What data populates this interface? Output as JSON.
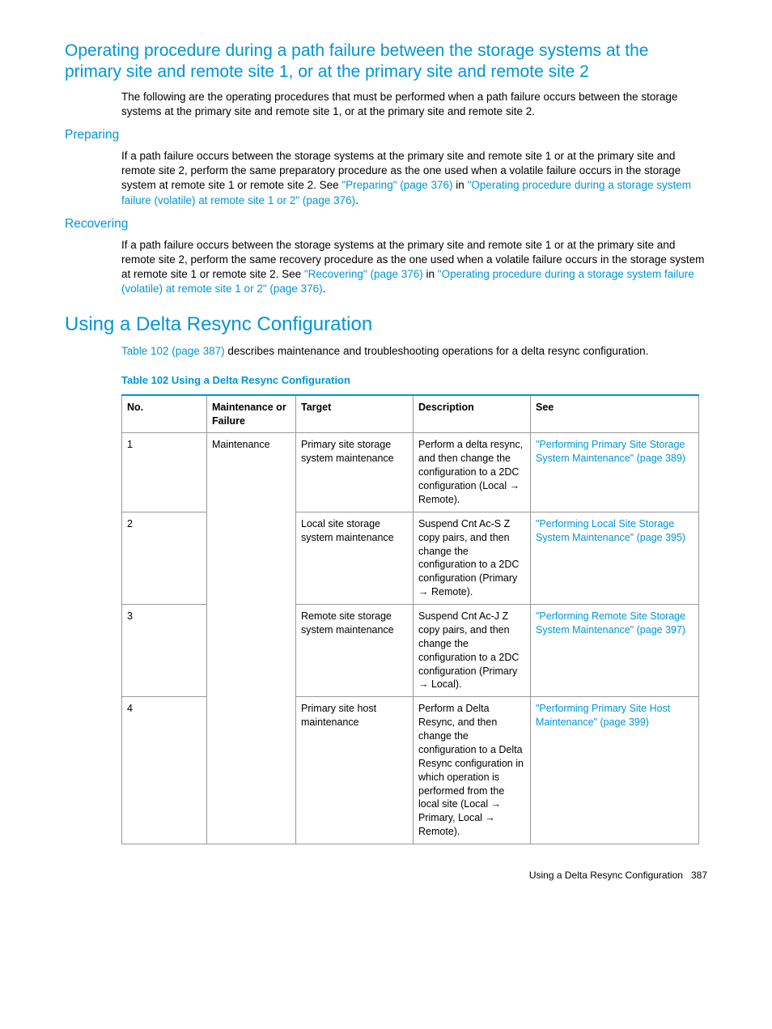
{
  "heading1": "Operating procedure during a path failure between the storage systems at the primary site and remote site 1, or at the primary site and remote site 2",
  "para1": "The following are the operating procedures that must be performed when a path failure occurs between the storage systems at the primary site and remote site 1, or at the primary site and remote site 2.",
  "preparing": {
    "title": "Preparing",
    "text_before": "If a path failure occurs between the storage systems at the primary site and remote site 1 or at the primary site and remote site 2, perform the same preparatory procedure as the one used when a volatile failure occurs in the storage system at remote site 1 or remote site 2. See ",
    "link1": "\"Preparing\" (page 376)",
    "mid": " in ",
    "link2": "\"Operating procedure during a storage system failure (volatile) at remote site 1 or 2\" (page 376)",
    "after": "."
  },
  "recovering": {
    "title": "Recovering",
    "text_before": "If a path failure occurs between the storage systems at the primary site and remote site 1 or at the primary site and remote site 2, perform the same recovery procedure as the one used when a volatile failure occurs in the storage system at remote site 1 or remote site 2. See ",
    "link1": "\"Recovering\" (page 376)",
    "mid": " in ",
    "link2": "\"Operating procedure during a storage system failure (volatile) at remote site 1 or 2\" (page 376)",
    "after": "."
  },
  "heading2": "Using a Delta Resync Configuration",
  "para2_link": "Table 102 (page 387)",
  "para2_rest": " describes maintenance and troubleshooting operations for a delta resync configuration.",
  "table_caption": "Table 102 Using a Delta Resync Configuration",
  "headers": {
    "no": "No.",
    "mf": "Maintenance or Failure",
    "target": "Target",
    "desc": "Description",
    "see": "See"
  },
  "rows": [
    {
      "no": "1",
      "mf": "Maintenance",
      "target": "Primary site storage system maintenance",
      "desc": "Perform a delta resync, and then change the configuration to a 2DC configuration (Local → Remote).",
      "see": "\"Performing Primary Site Storage System Maintenance\" (page 389)"
    },
    {
      "no": "2",
      "target": "Local site storage system maintenance",
      "desc": "Suspend Cnt Ac-S Z copy pairs, and then change the configuration to a 2DC configuration (Primary → Remote).",
      "see": "\"Performing Local Site Storage System Maintenance\" (page 395)"
    },
    {
      "no": "3",
      "target": "Remote site storage system maintenance",
      "desc": "Suspend Cnt Ac-J Z copy pairs, and then change the configuration to a 2DC configuration (Primary → Local).",
      "see": "\"Performing Remote Site Storage System Maintenance\" (page 397)"
    },
    {
      "no": "4",
      "target": "Primary site host maintenance",
      "desc": "Perform a Delta Resync, and then change the configuration to a Delta Resync configuration in which operation is performed from the local site (Local → Primary, Local → Remote).",
      "see": "\"Performing Primary Site Host Maintenance\" (page 399)"
    }
  ],
  "footer_text": "Using a Delta Resync Configuration",
  "footer_page": "387"
}
